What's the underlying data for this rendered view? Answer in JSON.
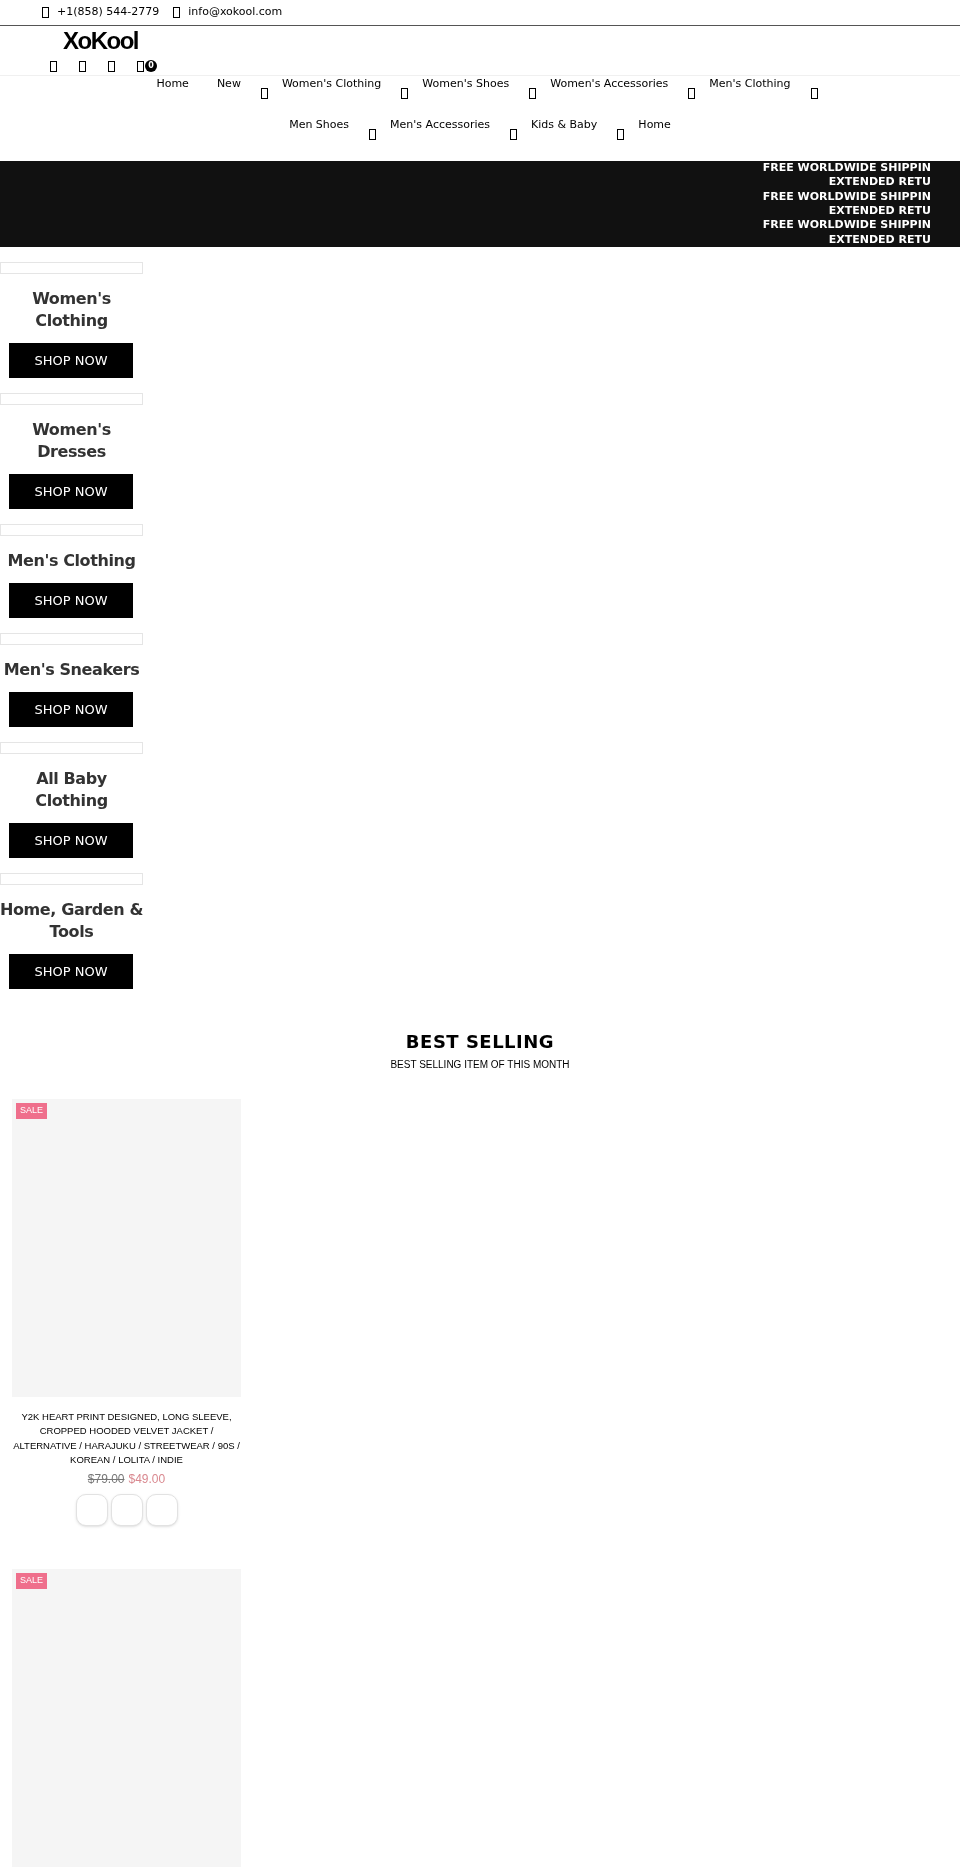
{
  "top_bar": {
    "phone": "+1(858) 544-2779",
    "email": "info@xokool.com"
  },
  "header": {
    "logo": "XoKool",
    "cart_count": "0"
  },
  "nav": [
    {
      "label": "Home",
      "dropdown": false
    },
    {
      "label": "New",
      "dropdown": false
    },
    {
      "label": "Women's Clothing",
      "dropdown": true
    },
    {
      "label": "Women's Shoes",
      "dropdown": true
    },
    {
      "label": "Women's Accessories",
      "dropdown": true
    },
    {
      "label": "Men's Clothing",
      "dropdown": true
    },
    {
      "label": "Men Shoes",
      "dropdown": true
    },
    {
      "label": "Men's Accessories",
      "dropdown": true
    },
    {
      "label": "Kids & Baby",
      "dropdown": true
    },
    {
      "label": "Home",
      "dropdown": true
    }
  ],
  "announcements": [
    "FREE WORLDWIDE SHIPPIN",
    "EXTENDED RETU",
    "FREE WORLDWIDE SHIPPIN",
    "EXTENDED RETU",
    "FREE WORLDWIDE SHIPPIN",
    "EXTENDED RETU"
  ],
  "categories": [
    {
      "title": "Women's Clothing",
      "button": "SHOP NOW"
    },
    {
      "title": "Women's Dresses",
      "button": "SHOP NOW"
    },
    {
      "title": "Men's Clothing",
      "button": "SHOP NOW"
    },
    {
      "title": "Men's Sneakers",
      "button": "SHOP NOW"
    },
    {
      "title": "All Baby Clothing",
      "button": "SHOP NOW"
    },
    {
      "title": "Home, Garden & Tools",
      "button": "SHOP NOW"
    }
  ],
  "best_selling": {
    "title": "BEST SELLING",
    "subtitle": "BEST SELLING ITEM OF THIS MONTH",
    "products": [
      {
        "badge": "SALE",
        "name": "Y2K HEART PRINT DESIGNED, LONG SLEEVE, CROPPED HOODED VELVET JACKET / ALTERNATIVE / HARAJUKU / STREETWEAR / 90S / KOREAN / LOLITA / INDIE",
        "old_price": "$79.00",
        "price": "$49.00"
      },
      {
        "badge": "SALE"
      }
    ]
  }
}
